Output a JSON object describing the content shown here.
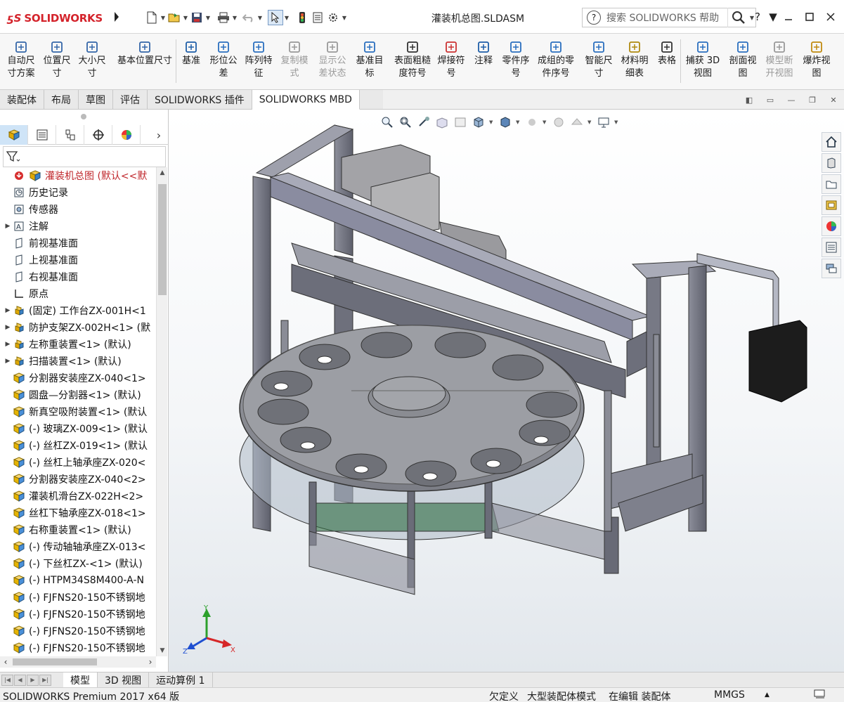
{
  "app": {
    "logo_text": "SOLIDWORKS",
    "document_title": "灌装机总图.SLDASM",
    "search_placeholder": "搜索 SOLIDWORKS 帮助",
    "help_label": "?",
    "accent_color": "#d4232b"
  },
  "quick_access": [
    {
      "name": "new-document",
      "icon": "new-file-icon"
    },
    {
      "name": "open-document",
      "icon": "open-folder-icon"
    },
    {
      "name": "save-document",
      "icon": "save-icon"
    },
    {
      "name": "print-document",
      "icon": "print-icon"
    },
    {
      "name": "undo",
      "icon": "undo-icon"
    },
    {
      "name": "select",
      "icon": "pointer-icon"
    },
    {
      "name": "rebuild",
      "icon": "traffic-light-icon"
    },
    {
      "name": "file-properties",
      "icon": "file-properties-icon"
    },
    {
      "name": "options",
      "icon": "gear-icon"
    }
  ],
  "commands": [
    {
      "label": "自动尺\n寸方案",
      "disabled": false,
      "icon": "auto-dimension-icon"
    },
    {
      "label": "位置尺\n寸",
      "disabled": false,
      "icon": "location-dimension-icon"
    },
    {
      "label": "大小尺\n寸",
      "disabled": false,
      "icon": "size-dimension-icon"
    },
    {
      "label": "基本位置尺寸",
      "disabled": false,
      "icon": "basic-location-icon"
    },
    {
      "label": "基准",
      "disabled": false,
      "icon": "datum-icon"
    },
    {
      "label": "形位公\n差",
      "disabled": false,
      "icon": "geometric-tolerance-icon"
    },
    {
      "label": "阵列特\n征",
      "disabled": false,
      "icon": "pattern-feature-icon"
    },
    {
      "label": "复制模\n式",
      "disabled": true,
      "icon": "copy-scheme-icon"
    },
    {
      "label": "显示公\n差状态",
      "disabled": true,
      "icon": "tolerance-status-icon"
    },
    {
      "label": "基准目\n标",
      "disabled": false,
      "icon": "datum-target-icon"
    },
    {
      "label": "表面粗糙\n度符号",
      "disabled": false,
      "icon": "surface-finish-icon"
    },
    {
      "label": "焊接符\n号",
      "disabled": false,
      "icon": "weld-symbol-icon"
    },
    {
      "label": "注释",
      "disabled": false,
      "icon": "note-icon"
    },
    {
      "label": "零件序\n号",
      "disabled": false,
      "icon": "balloon-icon"
    },
    {
      "label": "成组的零\n件序号",
      "disabled": false,
      "icon": "stacked-balloon-icon"
    },
    {
      "label": "智能尺\n寸",
      "disabled": false,
      "icon": "smart-dimension-icon"
    },
    {
      "label": "材料明\n细表",
      "disabled": false,
      "icon": "bom-icon"
    },
    {
      "label": "表格",
      "disabled": false,
      "icon": "table-icon"
    },
    {
      "label": "捕获 3D\n视图",
      "disabled": false,
      "icon": "capture-3d-view-icon"
    },
    {
      "label": "剖面视\n图",
      "disabled": false,
      "icon": "section-view-icon"
    },
    {
      "label": "模型断\n开视图",
      "disabled": true,
      "icon": "break-view-icon"
    },
    {
      "label": "爆炸视\n图",
      "disabled": false,
      "icon": "explode-view-icon"
    }
  ],
  "ribbon_tabs": [
    "装配体",
    "布局",
    "草图",
    "评估",
    "SOLIDWORKS 插件",
    "SOLIDWORKS MBD"
  ],
  "ribbon_active_tab": "SOLIDWORKS MBD",
  "panel_tabs": [
    "featuremanager-icon",
    "propertymanager-icon",
    "configurationmanager-icon",
    "dimxpert-icon",
    "display-manager-icon"
  ],
  "tree": [
    {
      "label": "灌装机总图  (默认<<默",
      "icon": "assembly-icon",
      "expandable": false,
      "root": true
    },
    {
      "label": "历史记录",
      "icon": "history-icon",
      "expandable": false
    },
    {
      "label": "传感器",
      "icon": "sensor-icon",
      "expandable": false
    },
    {
      "label": "注解",
      "icon": "annotation-icon",
      "expandable": true
    },
    {
      "label": "前视基准面",
      "icon": "plane-icon",
      "expandable": false
    },
    {
      "label": "上视基准面",
      "icon": "plane-icon",
      "expandable": false
    },
    {
      "label": "右视基准面",
      "icon": "plane-icon",
      "expandable": false
    },
    {
      "label": "原点",
      "icon": "origin-icon",
      "expandable": false
    },
    {
      "label": "(固定) 工作台ZX-001H<1",
      "icon": "subassembly-icon",
      "expandable": true
    },
    {
      "label": "防护支架ZX-002H<1> (默",
      "icon": "subassembly-icon",
      "expandable": true
    },
    {
      "label": "左称重装置<1> (默认)",
      "icon": "subassembly-icon",
      "expandable": true
    },
    {
      "label": "扫描装置<1> (默认)",
      "icon": "subassembly-icon",
      "expandable": true
    },
    {
      "label": "分割器安装座ZX-040<1>",
      "icon": "part-icon",
      "expandable": false
    },
    {
      "label": "圆盘—分割器<1> (默认)",
      "icon": "part-icon",
      "expandable": false
    },
    {
      "label": "新真空吸附装置<1> (默认",
      "icon": "part-icon",
      "expandable": false
    },
    {
      "label": "(-) 玻璃ZX-009<1> (默认",
      "icon": "part-icon",
      "expandable": false
    },
    {
      "label": "(-) 丝杠ZX-019<1> (默认",
      "icon": "part-icon",
      "expandable": false
    },
    {
      "label": "(-) 丝杠上轴承座ZX-020<",
      "icon": "part-icon",
      "expandable": false
    },
    {
      "label": "分割器安装座ZX-040<2>",
      "icon": "part-icon",
      "expandable": false
    },
    {
      "label": "灌装机滑台ZX-022H<2>",
      "icon": "part-icon",
      "expandable": false
    },
    {
      "label": "丝杠下轴承座ZX-018<1>",
      "icon": "part-icon",
      "expandable": false
    },
    {
      "label": "右称重装置<1> (默认)",
      "icon": "part-icon",
      "expandable": false
    },
    {
      "label": "(-) 传动轴轴承座ZX-013<",
      "icon": "part-icon",
      "expandable": false
    },
    {
      "label": "(-) 下丝杠ZX-<1> (默认)",
      "icon": "part-icon",
      "expandable": false
    },
    {
      "label": "(-) HTPM34S8M400-A-N",
      "icon": "part-icon",
      "expandable": false
    },
    {
      "label": "(-) FJFNS20-150不锈钢地",
      "icon": "part-icon",
      "expandable": false
    },
    {
      "label": "(-) FJFNS20-150不锈钢地",
      "icon": "part-icon",
      "expandable": false
    },
    {
      "label": "(-) FJFNS20-150不锈钢地",
      "icon": "part-icon",
      "expandable": false
    },
    {
      "label": "(-) FJFNS20-150不锈钢地",
      "icon": "part-icon",
      "expandable": false
    }
  ],
  "viewport": {
    "hud_icons": [
      "zoom-to-fit-icon",
      "zoom-to-area-icon",
      "previous-view-icon",
      "section-view-icon",
      "dynamic-annotation-icon",
      "view-orientation-icon",
      "display-style-icon",
      "hide-show-items-icon",
      "edit-appearance-icon",
      "apply-scene-icon",
      "view-settings-icon"
    ],
    "taskpane_icons": [
      "home-icon",
      "design-library-icon",
      "file-explorer-icon",
      "view-palette-icon",
      "appearances-icon",
      "custom-properties-icon",
      "forum-icon"
    ],
    "triad": {
      "x": "X",
      "y": "Y",
      "z": "Z"
    }
  },
  "bottom_tabs": [
    "模型",
    "3D 视图",
    "运动算例 1"
  ],
  "bottom_active_tab": "模型",
  "status": {
    "product": "SOLIDWORKS Premium 2017 x64 版",
    "definition": "欠定义",
    "mode": "大型装配体模式",
    "editing": "在编辑 装配体",
    "units": "MMGS"
  }
}
